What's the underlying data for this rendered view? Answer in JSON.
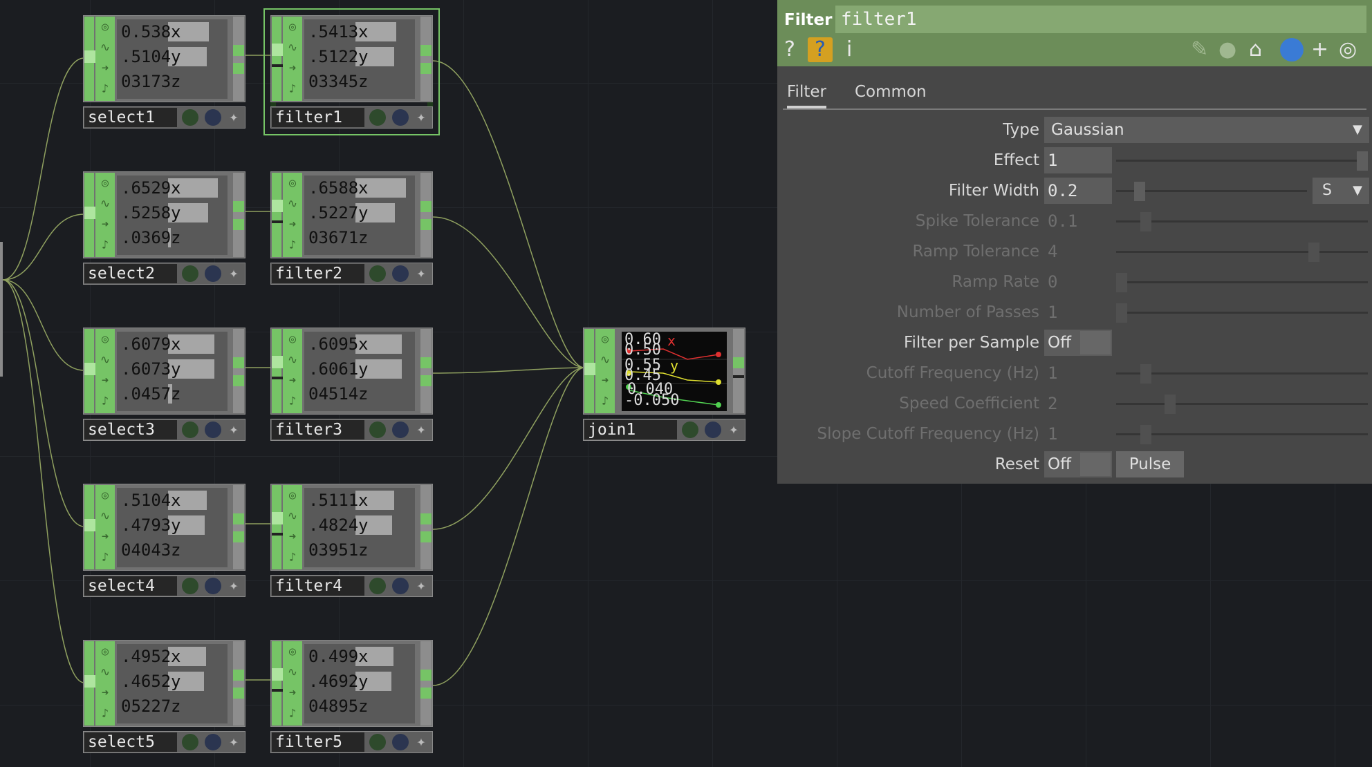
{
  "network": {
    "selects": [
      {
        "name": "select1",
        "x": "0.538",
        "y": ".5104",
        "z": "03173",
        "bx": 0.54,
        "by": 0.51,
        "bz": 0.0
      },
      {
        "name": "select2",
        "x": ".6529",
        "y": ".5258",
        "z": ".0369",
        "bx": 0.65,
        "by": 0.53,
        "bz": 0.04
      },
      {
        "name": "select3",
        "x": ".6079",
        "y": ".6073",
        "z": ".0457",
        "bx": 0.61,
        "by": 0.61,
        "bz": 0.05
      },
      {
        "name": "select4",
        "x": ".5104",
        "y": ".4793",
        "z": "04043",
        "bx": 0.51,
        "by": 0.48,
        "bz": 0.0
      },
      {
        "name": "select5",
        "x": ".4952",
        "y": ".4652",
        "z": "05227",
        "bx": 0.5,
        "by": 0.47,
        "bz": 0.0
      }
    ],
    "filters": [
      {
        "name": "filter1",
        "x": ".5413",
        "y": ".5122",
        "z": "03345",
        "bx": 0.54,
        "by": 0.51,
        "bz": 0.0
      },
      {
        "name": "filter2",
        "x": ".6588",
        "y": ".5227",
        "z": "03671",
        "bx": 0.66,
        "by": 0.52,
        "bz": 0.0
      },
      {
        "name": "filter3",
        "x": ".6095",
        "y": ".6061",
        "z": "04514",
        "bx": 0.61,
        "by": 0.61,
        "bz": 0.0
      },
      {
        "name": "filter4",
        "x": ".5111",
        "y": ".4824",
        "z": "03951",
        "bx": 0.51,
        "by": 0.48,
        "bz": 0.0
      },
      {
        "name": "filter5",
        "x": "0.499",
        "y": ".4692",
        "z": "04895",
        "bx": 0.5,
        "by": 0.47,
        "bz": 0.0
      }
    ],
    "channel_names": {
      "x": "x",
      "y": "y",
      "z": "z"
    },
    "join": {
      "name": "join1",
      "graph_labels": [
        "0.60",
        "0.50",
        "0.55",
        "0.45",
        "0.040",
        "-0.050"
      ],
      "channel_labels": {
        "x": "x",
        "y": "y"
      },
      "colors": {
        "x": "#e03030",
        "y": "#e0e030",
        "z": "#50d050"
      }
    },
    "wire_color": "#8fa05f"
  },
  "panel": {
    "op_type": "Filter",
    "op_name": "filter1",
    "tools": {
      "help": "?",
      "python_help": "?",
      "info": "i"
    },
    "tabs": [
      "Filter",
      "Common"
    ],
    "active_tab": "Filter",
    "params": {
      "type": {
        "label": "Type",
        "value": "Gaussian"
      },
      "effect": {
        "label": "Effect",
        "value": "1",
        "slider": 1.0
      },
      "filter_width": {
        "label": "Filter Width",
        "value": "0.2",
        "slider": 0.1,
        "unit": "S"
      },
      "spike_tolerance": {
        "label": "Spike Tolerance",
        "value": "0.1",
        "slider": 0.1
      },
      "ramp_tolerance": {
        "label": "Ramp Tolerance",
        "value": "4",
        "slider": 0.8
      },
      "ramp_rate": {
        "label": "Ramp Rate",
        "value": "0",
        "slider": 0.0
      },
      "number_of_passes": {
        "label": "Number of Passes",
        "value": "1",
        "slider": 0.0
      },
      "filter_per_sample": {
        "label": "Filter per Sample",
        "value": "Off"
      },
      "cutoff_frequency": {
        "label": "Cutoff Frequency (Hz)",
        "value": "1",
        "slider": 0.1
      },
      "speed_coefficient": {
        "label": "Speed Coefficient",
        "value": "2",
        "slider": 0.2
      },
      "slope_cutoff_frequency": {
        "label": "Slope Cutoff Frequency (Hz)",
        "value": "1",
        "slider": 0.1
      },
      "reset": {
        "label": "Reset",
        "value": "Off",
        "pulse_label": "Pulse"
      }
    }
  }
}
